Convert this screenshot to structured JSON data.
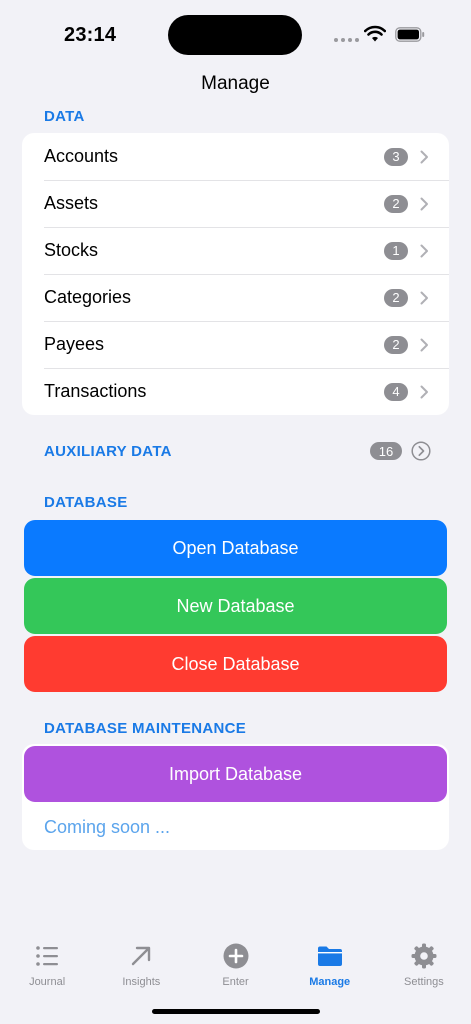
{
  "status": {
    "time": "23:14"
  },
  "nav": {
    "title": "Manage"
  },
  "sections": {
    "data": "DATA",
    "auxiliary": "AUXILIARY DATA",
    "database": "DATABASE",
    "maintenance": "DATABASE MAINTENANCE"
  },
  "data_rows": [
    {
      "label": "Accounts",
      "count": "3"
    },
    {
      "label": "Assets",
      "count": "2"
    },
    {
      "label": "Stocks",
      "count": "1"
    },
    {
      "label": "Categories",
      "count": "2"
    },
    {
      "label": "Payees",
      "count": "2"
    },
    {
      "label": "Transactions",
      "count": "4"
    }
  ],
  "auxiliary": {
    "count": "16"
  },
  "database_buttons": {
    "open": "Open Database",
    "new": "New Database",
    "close": "Close Database"
  },
  "maintenance": {
    "import": "Import Database",
    "coming_soon": "Coming soon ..."
  },
  "tabs": [
    {
      "label": "Journal",
      "icon": "list-icon"
    },
    {
      "label": "Insights",
      "icon": "arrow-up-right-icon"
    },
    {
      "label": "Enter",
      "icon": "plus-circle-icon"
    },
    {
      "label": "Manage",
      "icon": "folder-icon",
      "active": true
    },
    {
      "label": "Settings",
      "icon": "gear-icon"
    }
  ],
  "colors": {
    "accent": "#1a7ae6",
    "open_button": "#0a7aff",
    "new_button": "#34c759",
    "close_button": "#ff3b30",
    "import_button": "#af52de",
    "badge": "#8e8e93",
    "background": "#F2F2F7"
  }
}
